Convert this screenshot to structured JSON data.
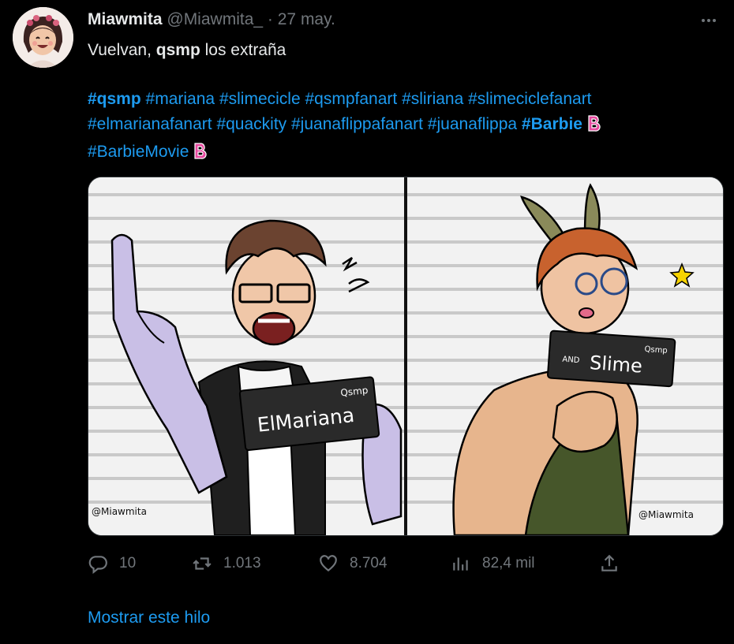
{
  "tweet": {
    "author_name": "Miawmita",
    "handle": "@Miawmita_",
    "separator": "·",
    "date": "27 may.",
    "text_prefix": "Vuelvan, ",
    "text_bold": "qsmp",
    "text_suffix": " los extraña",
    "hashtags_line1": [
      "#qsmp",
      "#mariana",
      "#slimecicle",
      "#qsmpfanart",
      "#sliriana",
      "#slimeciclefanart"
    ],
    "hashtags_line2": [
      "#elmarianafanart",
      "#quackity",
      "#juanaflippafanart",
      "#juanaflippa",
      "#Barbie"
    ],
    "hashtags_line3": [
      "#BarbieMovie"
    ]
  },
  "media": {
    "left_card_text": "ElMariana",
    "left_card_label": "Qsmp",
    "right_card_small": "AND",
    "right_card_text": "Slime",
    "right_card_label": "Qsmp",
    "left_watermark": "@Miawmita",
    "right_watermark": "@Miawmita"
  },
  "actions": {
    "replies": "10",
    "retweets": "1.013",
    "likes": "8.704",
    "views": "82,4 mil"
  },
  "show_thread": "Mostrar este hilo",
  "colors": {
    "accent": "#1d9bf0",
    "muted": "#71767b",
    "text": "#e7e9ea",
    "background": "#000000"
  },
  "icons": [
    "more-icon",
    "reply-icon",
    "retweet-icon",
    "like-icon",
    "views-icon",
    "share-icon",
    "barbie-icon"
  ]
}
